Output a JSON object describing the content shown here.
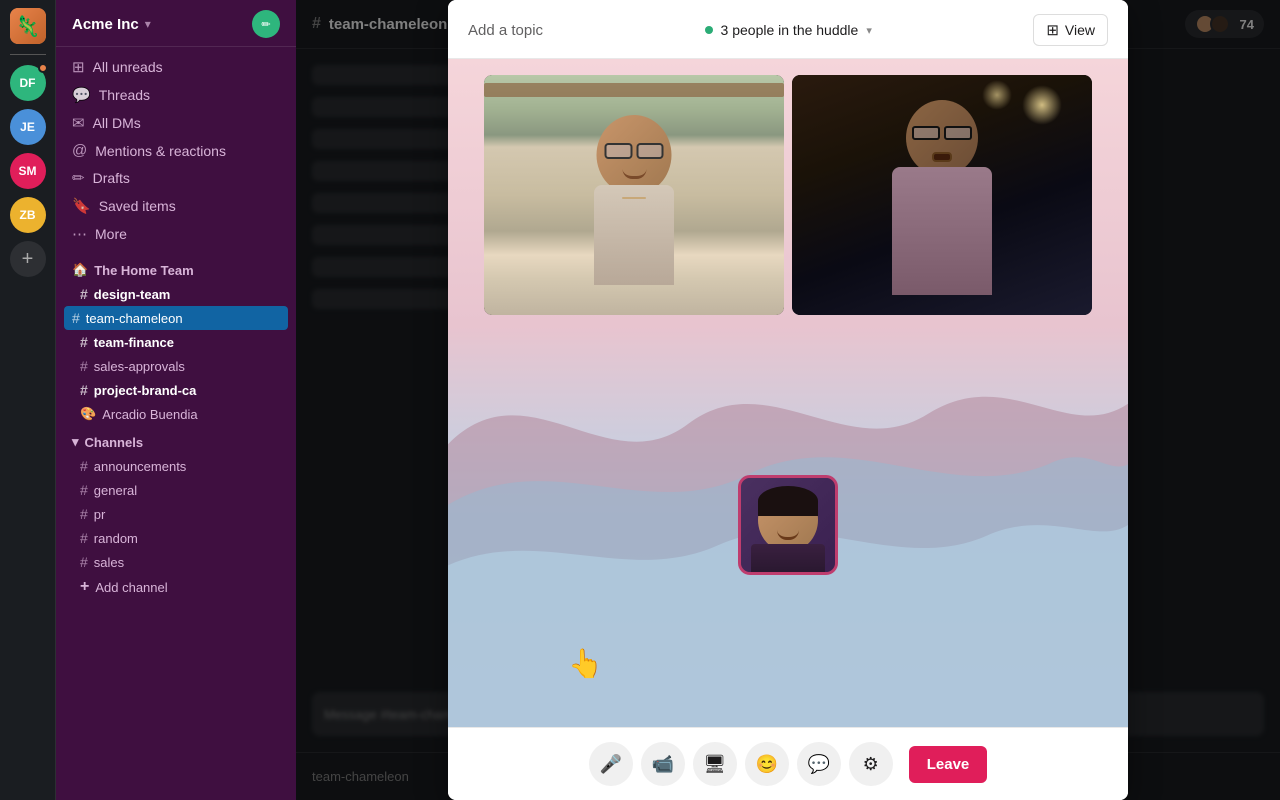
{
  "workspace": {
    "name": "Acme Inc",
    "chevron": "▾"
  },
  "sidebar_users": [
    {
      "initials": "DF",
      "color": "#2eb67d",
      "has_badge": true
    },
    {
      "initials": "JE",
      "color": "#4a90d9"
    },
    {
      "initials": "SM",
      "color": "#e01e5a"
    },
    {
      "initials": "ZB",
      "color": "#ecb22e"
    }
  ],
  "nav_items": [
    {
      "id": "unreads",
      "icon": "⊞",
      "label": "All unreads"
    },
    {
      "id": "threads",
      "icon": "💬",
      "label": "Threads"
    },
    {
      "id": "all-dms",
      "icon": "✉",
      "label": "All DMs"
    },
    {
      "id": "mentions",
      "icon": "🔔",
      "label": "Mentions & reactions"
    },
    {
      "id": "drafts",
      "icon": "✏",
      "label": "Drafts"
    },
    {
      "id": "saved",
      "icon": "🔖",
      "label": "Saved items"
    },
    {
      "id": "more",
      "icon": "⋯",
      "label": "More"
    }
  ],
  "home_team": {
    "label": "The Home Team",
    "icon": "🏠"
  },
  "channels_section": {
    "label": "Channels",
    "chevron": "▾"
  },
  "direct_channels": [
    {
      "name": "design-team",
      "bold": false
    },
    {
      "name": "team-chameleon",
      "active": true,
      "bold": false
    },
    {
      "name": "team-finance",
      "bold": true
    },
    {
      "name": "sales-approvals",
      "bold": false
    },
    {
      "name": "project-brand-ca",
      "bold": true
    }
  ],
  "direct_messages": [
    {
      "name": "Arcadio Buendia",
      "icon": "🎨"
    }
  ],
  "channels": [
    {
      "name": "announcements"
    },
    {
      "name": "general"
    },
    {
      "name": "pr"
    },
    {
      "name": "random"
    },
    {
      "name": "sales"
    }
  ],
  "add_channel_label": "Add channel",
  "channel_name": "# team-chameleon",
  "huddle": {
    "topic_label": "Add a topic",
    "participants_label": "3 people in the huddle",
    "view_label": "View",
    "leave_label": "Leave"
  },
  "controls": [
    {
      "id": "mic",
      "icon": "🎤",
      "label": "Mute/unmute"
    },
    {
      "id": "video",
      "icon": "📹",
      "label": "Video"
    },
    {
      "id": "screen",
      "icon": "🖥",
      "label": "Share screen"
    },
    {
      "id": "emoji",
      "icon": "😊",
      "label": "React"
    },
    {
      "id": "chat",
      "icon": "💬",
      "label": "Chat"
    },
    {
      "id": "settings",
      "icon": "⚙",
      "label": "Settings"
    }
  ],
  "footer": {
    "channel": "team-chameleon"
  },
  "header_avatars": {
    "count": "74"
  }
}
